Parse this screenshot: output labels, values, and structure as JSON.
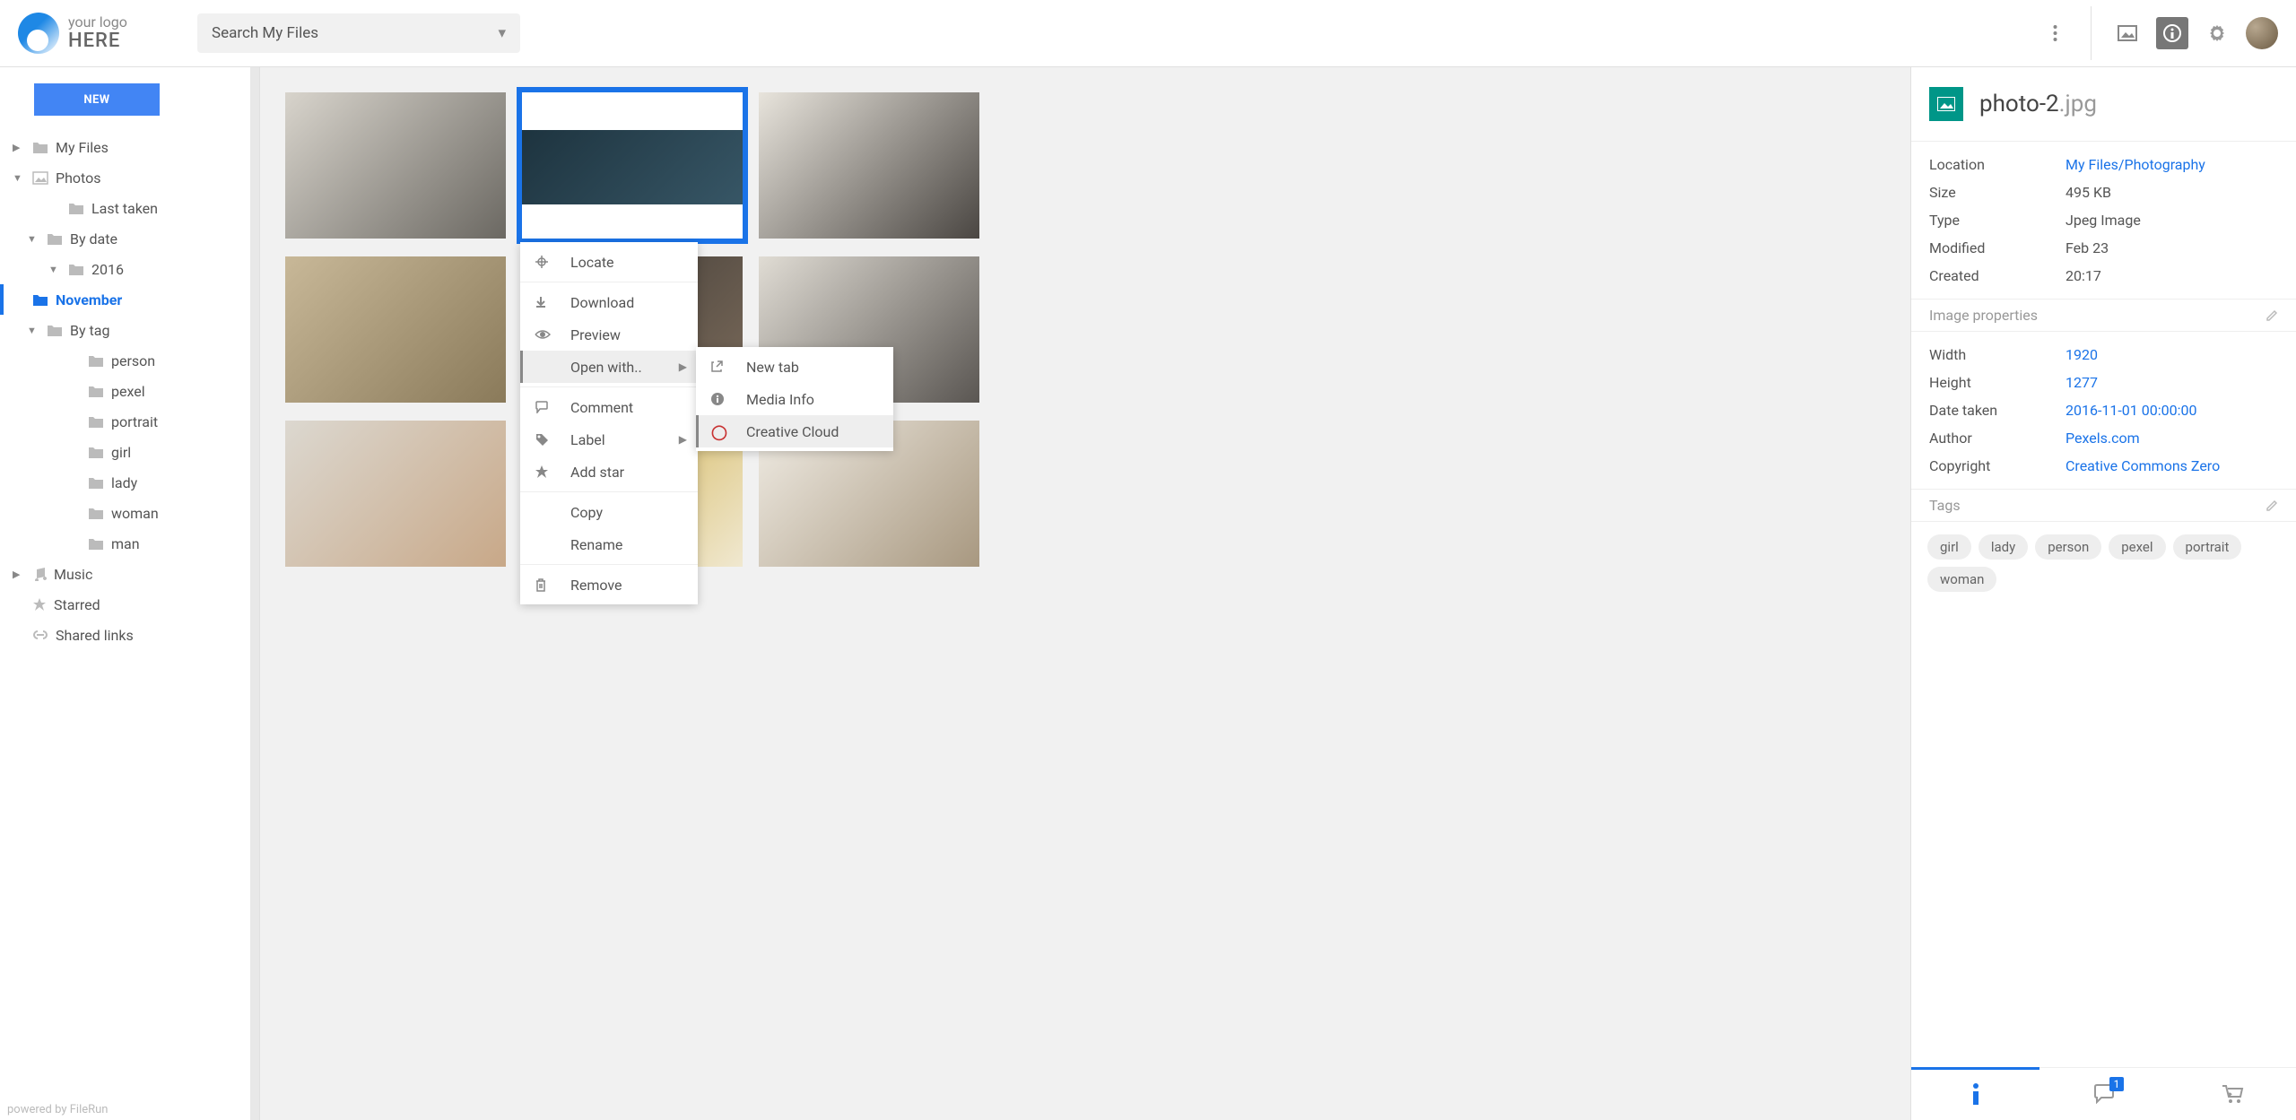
{
  "header": {
    "logo_top": "your logo",
    "logo_bottom": "HERE",
    "search_placeholder": "Search My Files"
  },
  "sidebar": {
    "new_button": "NEW",
    "items": [
      {
        "label": "My Files",
        "icon": "folder",
        "indent": 0,
        "caret": "right"
      },
      {
        "label": "Photos",
        "icon": "image",
        "indent": 0,
        "caret": "down"
      },
      {
        "label": "Last taken",
        "icon": "folder",
        "indent": 2,
        "caret": ""
      },
      {
        "label": "By date",
        "icon": "folder",
        "indent": 1,
        "caret": "down"
      },
      {
        "label": "2016",
        "icon": "folder",
        "indent": 2,
        "caret": "down"
      },
      {
        "label": "November",
        "icon": "folder",
        "indent": 4,
        "caret": "",
        "active": true
      },
      {
        "label": "By tag",
        "icon": "folder",
        "indent": 1,
        "caret": "down"
      },
      {
        "label": "person",
        "icon": "folder",
        "indent": 3,
        "caret": ""
      },
      {
        "label": "pexel",
        "icon": "folder",
        "indent": 3,
        "caret": ""
      },
      {
        "label": "portrait",
        "icon": "folder",
        "indent": 3,
        "caret": ""
      },
      {
        "label": "girl",
        "icon": "folder",
        "indent": 3,
        "caret": ""
      },
      {
        "label": "lady",
        "icon": "folder",
        "indent": 3,
        "caret": ""
      },
      {
        "label": "woman",
        "icon": "folder",
        "indent": 3,
        "caret": ""
      },
      {
        "label": "man",
        "icon": "folder",
        "indent": 3,
        "caret": ""
      },
      {
        "label": "Music",
        "icon": "music",
        "indent": 0,
        "caret": "right"
      },
      {
        "label": "Starred",
        "icon": "star",
        "indent": 0,
        "caret": ""
      },
      {
        "label": "Shared links",
        "icon": "link",
        "indent": 0,
        "caret": ""
      }
    ],
    "powered": "powered by FileRun"
  },
  "context_menu": {
    "items": [
      {
        "label": "Locate",
        "icon": "locate"
      },
      {
        "label": "Download",
        "icon": "download"
      },
      {
        "label": "Preview",
        "icon": "eye"
      },
      {
        "label": "Open with..",
        "icon": "",
        "arrow": true,
        "hover": true
      },
      {
        "label": "Comment",
        "icon": "comment"
      },
      {
        "label": "Label",
        "icon": "tag",
        "arrow": true
      },
      {
        "label": "Add star",
        "icon": "star"
      },
      {
        "label": "Copy",
        "icon": ""
      },
      {
        "label": "Rename",
        "icon": ""
      },
      {
        "label": "Remove",
        "icon": "trash"
      }
    ],
    "submenu": [
      {
        "label": "New tab",
        "icon": "external"
      },
      {
        "label": "Media Info",
        "icon": "info"
      },
      {
        "label": "Creative Cloud",
        "icon": "cc",
        "hover": true
      }
    ]
  },
  "details": {
    "filename": "photo-2",
    "ext": ".jpg",
    "rows": [
      {
        "label": "Location",
        "value": "My Files/Photography",
        "link": true
      },
      {
        "label": "Size",
        "value": "495 KB"
      },
      {
        "label": "Type",
        "value": "Jpeg Image"
      },
      {
        "label": "Modified",
        "value": "Feb 23"
      },
      {
        "label": "Created",
        "value": "20:17"
      }
    ],
    "section1": "Image properties",
    "props": [
      {
        "label": "Width",
        "value": "1920",
        "link": true
      },
      {
        "label": "Height",
        "value": "1277",
        "link": true
      },
      {
        "label": "Date taken",
        "value": "2016-11-01 00:00:00",
        "link": true
      },
      {
        "label": "Author",
        "value": "Pexels.com",
        "link": true
      },
      {
        "label": "Copyright",
        "value": "Creative Commons Zero",
        "link": true
      }
    ],
    "section2": "Tags",
    "tags": [
      "girl",
      "lady",
      "person",
      "pexel",
      "portrait",
      "woman"
    ],
    "comment_badge": "1"
  }
}
